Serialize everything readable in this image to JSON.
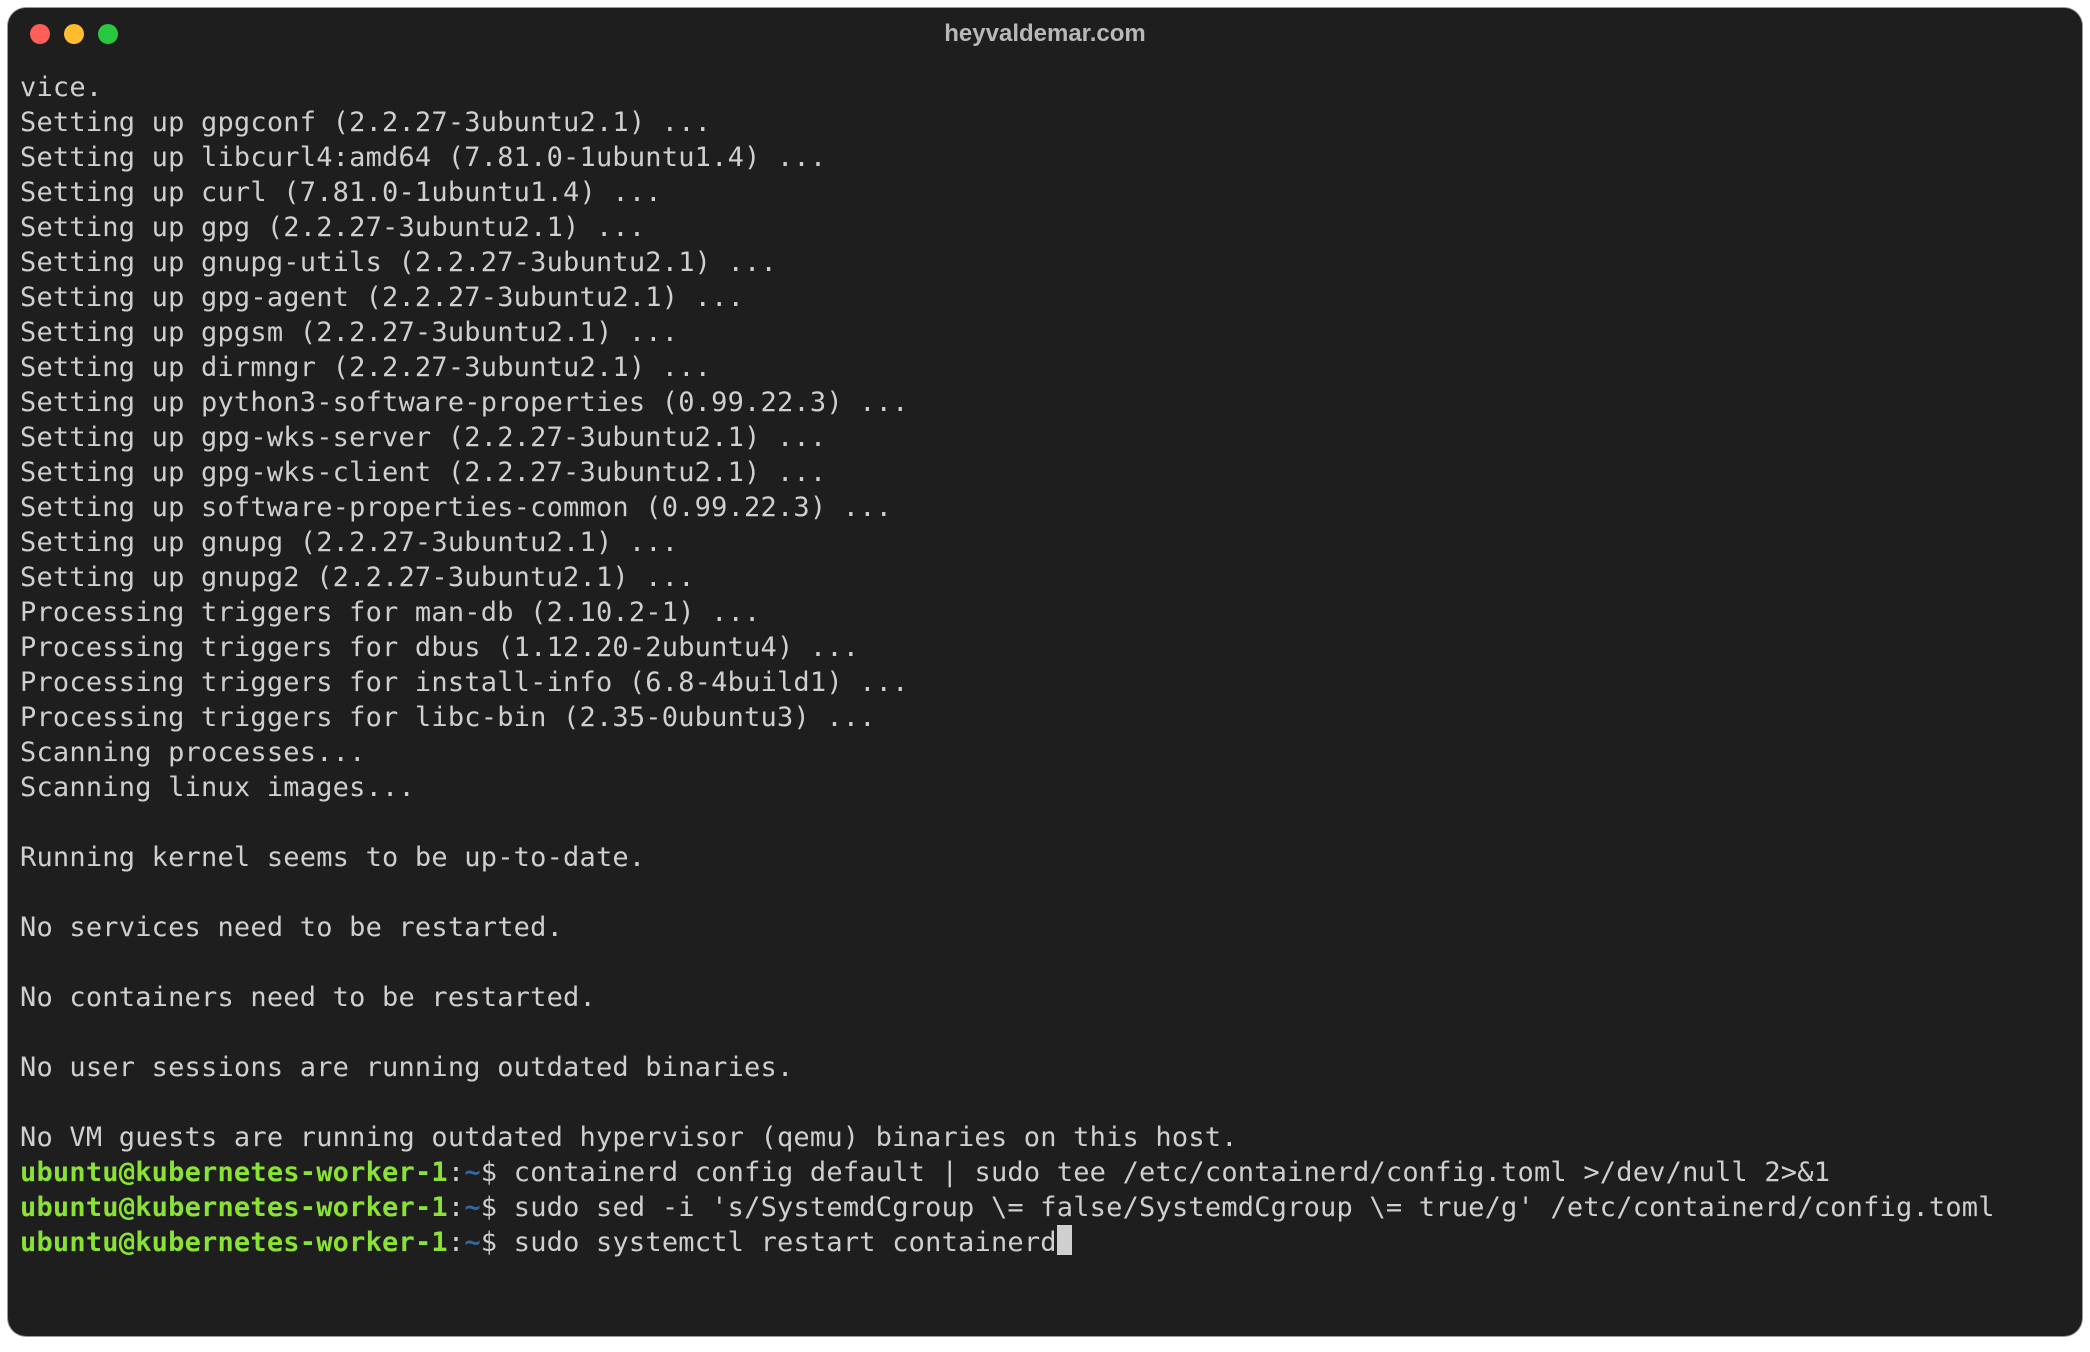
{
  "window": {
    "title": "heyvaldemar.com"
  },
  "colors": {
    "background": "#1e1e1e",
    "text": "#cfcfcf",
    "prompt_user": "#8ae234",
    "prompt_path": "#3465a4",
    "traffic_red": "#ff5f57",
    "traffic_yellow": "#febc2e",
    "traffic_green": "#28c840"
  },
  "prompt": {
    "user": "ubuntu",
    "host": "kubernetes-worker-1",
    "path": "~",
    "symbol": "$"
  },
  "output_lines": [
    "vice.",
    "Setting up gpgconf (2.2.27-3ubuntu2.1) ...",
    "Setting up libcurl4:amd64 (7.81.0-1ubuntu1.4) ...",
    "Setting up curl (7.81.0-1ubuntu1.4) ...",
    "Setting up gpg (2.2.27-3ubuntu2.1) ...",
    "Setting up gnupg-utils (2.2.27-3ubuntu2.1) ...",
    "Setting up gpg-agent (2.2.27-3ubuntu2.1) ...",
    "Setting up gpgsm (2.2.27-3ubuntu2.1) ...",
    "Setting up dirmngr (2.2.27-3ubuntu2.1) ...",
    "Setting up python3-software-properties (0.99.22.3) ...",
    "Setting up gpg-wks-server (2.2.27-3ubuntu2.1) ...",
    "Setting up gpg-wks-client (2.2.27-3ubuntu2.1) ...",
    "Setting up software-properties-common (0.99.22.3) ...",
    "Setting up gnupg (2.2.27-3ubuntu2.1) ...",
    "Setting up gnupg2 (2.2.27-3ubuntu2.1) ...",
    "Processing triggers for man-db (2.10.2-1) ...",
    "Processing triggers for dbus (1.12.20-2ubuntu4) ...",
    "Processing triggers for install-info (6.8-4build1) ...",
    "Processing triggers for libc-bin (2.35-0ubuntu3) ...",
    "Scanning processes...",
    "Scanning linux images...",
    "",
    "Running kernel seems to be up-to-date.",
    "",
    "No services need to be restarted.",
    "",
    "No containers need to be restarted.",
    "",
    "No user sessions are running outdated binaries.",
    "",
    "No VM guests are running outdated hypervisor (qemu) binaries on this host."
  ],
  "history": [
    {
      "command": "containerd config default | sudo tee /etc/containerd/config.toml >/dev/null 2>&1"
    },
    {
      "command": "sudo sed -i 's/SystemdCgroup \\= false/SystemdCgroup \\= true/g' /etc/containerd/config.toml"
    }
  ],
  "current_command": "sudo systemctl restart containerd"
}
